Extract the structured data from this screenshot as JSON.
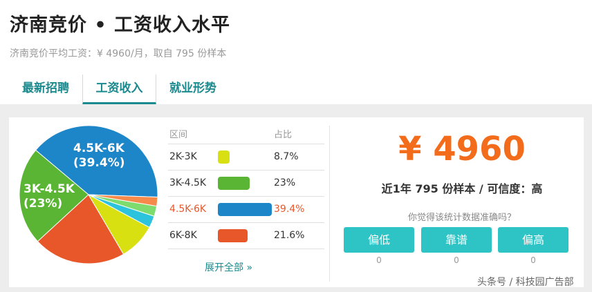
{
  "header": {
    "title": "济南竞价 • 工资收入水平",
    "subtitle": "济南竞价平均工资：¥ 4960/月，取自 795 份样本"
  },
  "tabs": [
    {
      "label": "最新招聘",
      "active": false
    },
    {
      "label": "工资收入",
      "active": true
    },
    {
      "label": "就业形势",
      "active": false
    }
  ],
  "chart_data": {
    "type": "pie",
    "slices": [
      {
        "label": "4.5K-6K",
        "value": 39.4,
        "color": "#1d86c8"
      },
      {
        "label": "3K-4.5K",
        "value": 23,
        "color": "#5bb534"
      },
      {
        "label": "6K-8K",
        "value": 21.6,
        "color": "#e8572a"
      },
      {
        "label": "2K-3K",
        "value": 8.7,
        "color": "#d8e011"
      },
      {
        "label": "",
        "value": 2.8,
        "color": "#2ec3dd"
      },
      {
        "label": "",
        "value": 2.4,
        "color": "#7edc6e"
      },
      {
        "label": "",
        "value": 2.1,
        "color": "#f58a4b"
      }
    ],
    "pie_labels": [
      {
        "range": "4.5K-6K",
        "pct": "(39.4%)"
      },
      {
        "range": "3K-4.5K",
        "pct": "(23%)"
      }
    ]
  },
  "table": {
    "header_range": "区间",
    "header_pct": "占比",
    "rows": [
      {
        "range": "2K-3K",
        "pct": "8.7%",
        "value": 8.7,
        "color": "#d8e011",
        "highlight": false
      },
      {
        "range": "3K-4.5K",
        "pct": "23%",
        "value": 23,
        "color": "#5bb534",
        "highlight": false
      },
      {
        "range": "4.5K-6K",
        "pct": "39.4%",
        "value": 39.4,
        "color": "#1d86c8",
        "highlight": true
      },
      {
        "range": "6K-8K",
        "pct": "21.6%",
        "value": 21.6,
        "color": "#e8572a",
        "highlight": false
      }
    ],
    "expand_label": "展开全部 »"
  },
  "summary": {
    "salary": "¥ 4960",
    "sample_line": "近1年 795 份样本 / 可信度：高",
    "question": "你觉得该统计数据准确吗？"
  },
  "votes": [
    {
      "label": "偏低",
      "count": "0"
    },
    {
      "label": "靠谱",
      "count": "0"
    },
    {
      "label": "偏高",
      "count": "0"
    }
  ],
  "watermark": "头条号 / 科技园广告部"
}
